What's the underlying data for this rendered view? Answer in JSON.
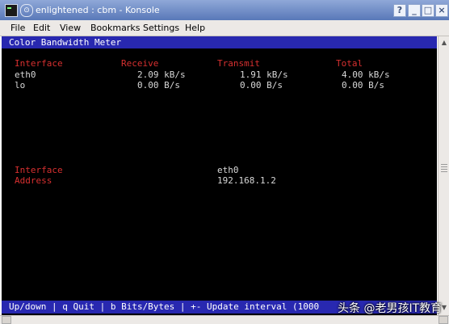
{
  "window": {
    "title": "enlightened : cbm - Konsole",
    "pin_glyph": "⊙",
    "buttons": [
      "?",
      "_",
      "□",
      "×"
    ]
  },
  "menu": [
    "File",
    "Edit",
    "View",
    "Bookmarks",
    "Settings",
    "Help"
  ],
  "app_title": "Color Bandwidth Meter",
  "table": {
    "headers": [
      "Interface",
      "Receive",
      "Transmit",
      "Total"
    ],
    "rows": [
      {
        "iface": "eth0",
        "receive": "2.09 kB/s",
        "transmit": "1.91 kB/s",
        "total": "4.00 kB/s"
      },
      {
        "iface": "lo",
        "receive": "0.00 B/s",
        "transmit": "0.00 B/s",
        "total": "0.00 B/s"
      }
    ]
  },
  "details": {
    "interface_label": "Interface",
    "interface_value": "eth0",
    "address_label": "Address",
    "address_value": "192.168.1.2"
  },
  "help_line": "Up/down | q Quit | b Bits/Bytes | +- Update interval (1000",
  "watermark": "头条 @老男孩IT教育",
  "colors": {
    "terminal_bg": "#000000",
    "bar_bg": "#2828b0",
    "label": "#d83030",
    "value": "#d8d8d8",
    "titlebar": "#6f8cc8"
  }
}
